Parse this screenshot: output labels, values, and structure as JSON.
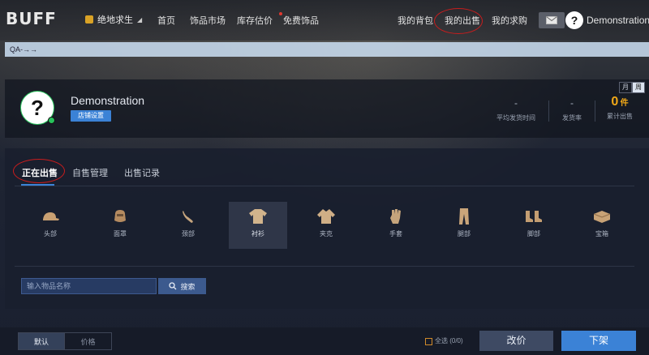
{
  "header": {
    "logo": "BUFF",
    "game": "绝地求生",
    "nav": [
      "首页",
      "饰品市场",
      "库存估价",
      "免费饰品"
    ],
    "user_nav": [
      "我的背包",
      "我的出售",
      "我的求购"
    ],
    "username": "Demonstration",
    "avatar_glyph": "?"
  },
  "qa_bar": {
    "text": "QA-→→"
  },
  "profile": {
    "username": "Demonstration",
    "avatar_glyph": "?",
    "shop_settings_label": "店铺设置",
    "period_toggle": [
      "月",
      "周"
    ],
    "stats": [
      {
        "value": "-",
        "label": "平均发货时间"
      },
      {
        "value": "-",
        "label": "发货率"
      },
      {
        "value": "0",
        "unit": "件",
        "label": "累计出售"
      }
    ]
  },
  "tabs": [
    "正在出售",
    "自售管理",
    "出售记录"
  ],
  "categories": [
    {
      "label": "头部",
      "icon": "cap-icon"
    },
    {
      "label": "面罩",
      "icon": "mask-icon"
    },
    {
      "label": "颈部",
      "icon": "neck-icon"
    },
    {
      "label": "衬衫",
      "icon": "shirt-icon"
    },
    {
      "label": "夹克",
      "icon": "jacket-icon"
    },
    {
      "label": "手套",
      "icon": "glove-icon"
    },
    {
      "label": "腿部",
      "icon": "pants-icon"
    },
    {
      "label": "脚部",
      "icon": "boots-icon"
    },
    {
      "label": "宝箱",
      "icon": "crate-icon"
    }
  ],
  "search": {
    "placeholder": "输入物品名称",
    "button_label": "搜索"
  },
  "bottom": {
    "sort_default": "默认",
    "sort_price": "价格",
    "select_all": "全选 (0/0)",
    "change_price": "改价",
    "delist": "下架"
  },
  "colors": {
    "accent": "#3b82d6",
    "orange": "#f1a817",
    "online": "#27c25b",
    "annotation": "#c81d1d"
  }
}
